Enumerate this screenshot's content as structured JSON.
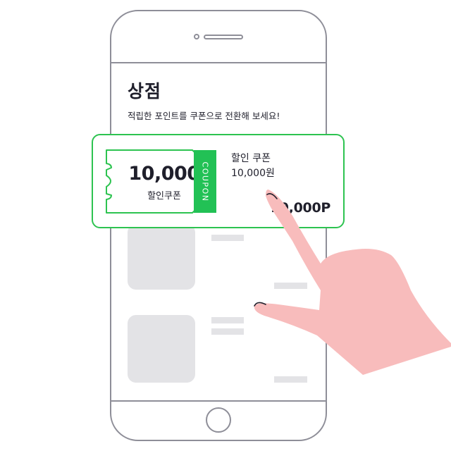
{
  "screen": {
    "title": "상점",
    "subtitle": "적립한 포인트를 쿠폰으로 전환해 보세요!"
  },
  "coupon_card": {
    "ticket_amount": "10,000",
    "ticket_label": "할인쿠폰",
    "tab_label": "COUPON",
    "name": "할인 쿠폰",
    "price": "10,000원",
    "points": "10,000P"
  },
  "colors": {
    "accent_green": "#22c155",
    "card_border": "#2dc350",
    "frame_gray": "#8e8e98",
    "placeholder_gray": "#e3e3e6",
    "hand_pink": "#f8bcbc"
  }
}
